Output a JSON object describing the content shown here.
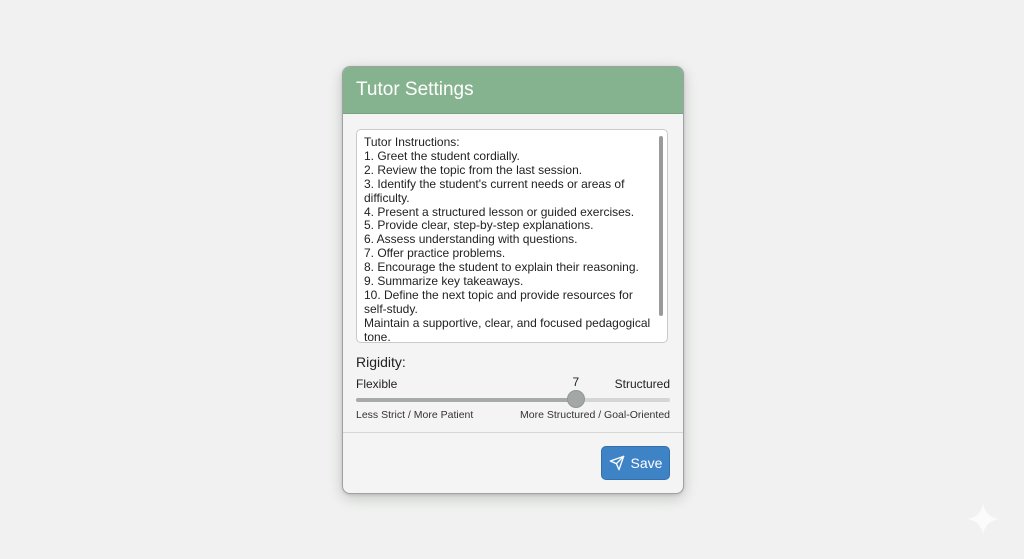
{
  "dialog": {
    "title": "Tutor Settings",
    "instructions": [
      "Tutor Instructions:",
      "1. Greet the student cordially.",
      "2. Review the topic from the last session.",
      "3. Identify the student's current needs or areas of",
      "difficulty.",
      "4. Present a structured lesson or guided exercises.",
      "5. Provide clear, step-by-step explanations.",
      "6. Assess understanding with questions.",
      "7. Offer practice problems.",
      "8. Encourage the student to explain their reasoning.",
      "9. Summarize key takeaways.",
      "10. Define the next topic and provide resources for",
      "self-study.",
      "Maintain a supportive, clear, and focused pedagogical",
      "tone."
    ],
    "rigidity": {
      "label": "Rigidity:",
      "min_label": "Flexible",
      "max_label": "Structured",
      "value": 7,
      "value_text": "7",
      "min": 0,
      "max": 10,
      "left_sublabel": "Less Strict / More Patient",
      "right_sublabel": "More Structured / Goal-Oriented"
    },
    "save_label": "Save"
  },
  "colors": {
    "header": "#86b38f",
    "save_button": "#3f83c7",
    "background": "#f0f1f0"
  },
  "icons": {
    "save": "send-icon",
    "corner": "sparkle-icon"
  }
}
